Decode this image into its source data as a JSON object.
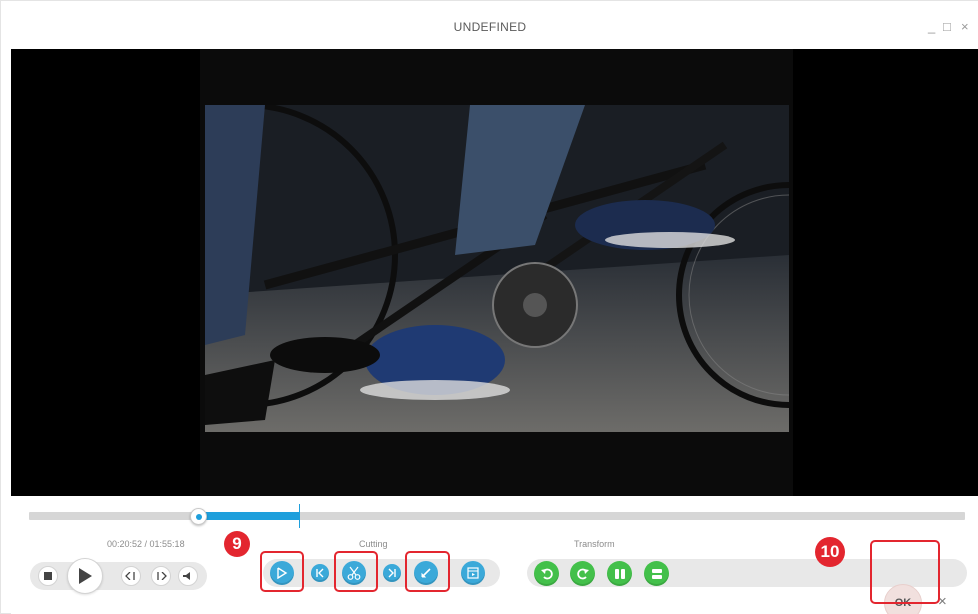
{
  "window": {
    "title": "UNDEFINED",
    "min_glyph": "_",
    "max_glyph": "□",
    "close_glyph": "×"
  },
  "playback": {
    "time": "00:20:52 / 01:55:18",
    "progress": 0.18
  },
  "groups": {
    "cutting_label": "Cutting",
    "transform_label": "Transform"
  },
  "player_icons": [
    "stop-icon",
    "play-icon",
    "step-back-icon",
    "step-forward-icon",
    "volume-icon"
  ],
  "cutting_icons": [
    "mark-icon",
    "go-start-icon",
    "scissors-icon",
    "go-end-icon",
    "edit-icon",
    "preview-icon"
  ],
  "transform_icons": [
    "rotate-left-icon",
    "rotate-right-icon",
    "flip-horizontal-icon",
    "flip-vertical-icon"
  ],
  "callouts": {
    "nine": "9",
    "ten": "10"
  },
  "actions": {
    "ok_label": "OK",
    "close_label": "×"
  },
  "colors": {
    "accent_blue": "#1e9fdc",
    "tool_blue": "#3ba9d9",
    "tool_green": "#43c04a",
    "callout_red": "#e3262f",
    "ok_bg": "#f1e0de"
  }
}
